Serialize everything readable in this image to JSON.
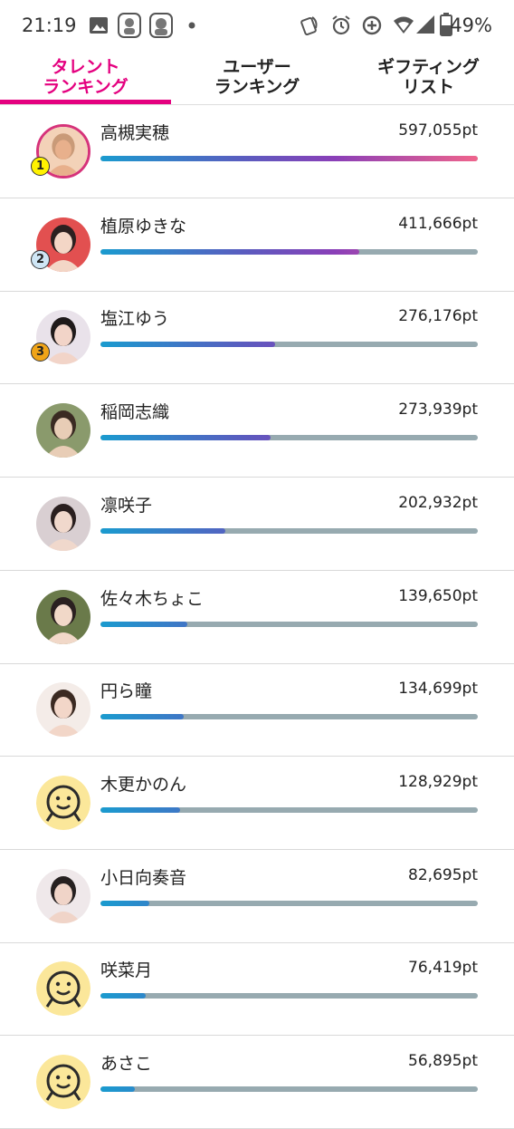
{
  "status_bar": {
    "time": "21:19",
    "battery": "49%"
  },
  "tabs": [
    {
      "label": "タレント\nランキング",
      "active": true
    },
    {
      "label": "ユーザー\nランキング",
      "active": false
    },
    {
      "label": "ギフティング\nリスト",
      "active": false
    }
  ],
  "colors": {
    "accent": "#e4007f",
    "bar_track": "#97aab0",
    "bar_gradient_start": "#1a9bcf",
    "bar_gradient_mid": "#8a3fb8",
    "bar_gradient_end": "#f0648c",
    "rank1": "#fff200",
    "rank2": "#cfe6f5",
    "rank3": "#f0a418"
  },
  "ranking": [
    {
      "name": "高槻実穂",
      "points": "597,055pt",
      "progress": 1.0,
      "rank_badge": "1",
      "avatar": "photo"
    },
    {
      "name": "植原ゆきな",
      "points": "411,666pt",
      "progress": 0.685,
      "rank_badge": "2",
      "avatar": "photo"
    },
    {
      "name": "塩江ゆう",
      "points": "276,176pt",
      "progress": 0.462,
      "rank_badge": "3",
      "avatar": "photo"
    },
    {
      "name": "稲岡志織",
      "points": "273,939pt",
      "progress": 0.452,
      "rank_badge": "",
      "avatar": "photo"
    },
    {
      "name": "凛咲子",
      "points": "202,932pt",
      "progress": 0.332,
      "rank_badge": "",
      "avatar": "photo"
    },
    {
      "name": "佐々木ちょこ",
      "points": "139,650pt",
      "progress": 0.23,
      "rank_badge": "",
      "avatar": "photo"
    },
    {
      "name": "円ら瞳",
      "points": "134,699pt",
      "progress": 0.22,
      "rank_badge": "",
      "avatar": "photo"
    },
    {
      "name": "木更かのん",
      "points": "128,929pt",
      "progress": 0.21,
      "rank_badge": "",
      "avatar": "placeholder"
    },
    {
      "name": "小日向奏音",
      "points": "82,695pt",
      "progress": 0.13,
      "rank_badge": "",
      "avatar": "photo"
    },
    {
      "name": "咲菜月",
      "points": "76,419pt",
      "progress": 0.12,
      "rank_badge": "",
      "avatar": "placeholder"
    },
    {
      "name": "あさこ",
      "points": "56,895pt",
      "progress": 0.09,
      "rank_badge": "",
      "avatar": "placeholder"
    }
  ]
}
